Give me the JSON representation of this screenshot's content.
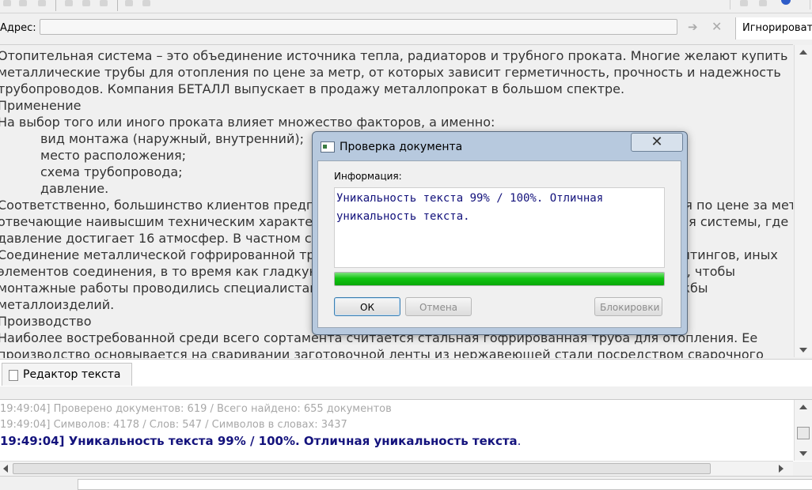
{
  "address_bar": {
    "label": "Адрес:",
    "value": "",
    "ignore_label": "Игнорировать"
  },
  "editor": {
    "lines": [
      "Отопительная система – это объединение источника тепла, радиаторов и трубного проката. Многие желают  купить",
      "металлические трубы для отопления по цене за метр, от которых зависит герметичность, прочность и надежность",
      "трубопроводов. Компания БЕТАЛЛ выпускает в продажу металлопрокат в большом спектре.",
      "Применение",
      "На выбор того или иного проката влияет множество факторов, а именно:",
      "вид монтажа (наружный, внутренний);",
      "место расположения;",
      "схема трубопровода;",
      "давление.",
      "Соответственно, большинство клиентов предпочитают покупать металлические трубы для отопления по цене за метр,",
      "отвечающие наивысшим техническим характеристикам, которые можно использовать в том числе для системы, где",
      "давление достигает 16 атмосфер. В частном строительстве важную роль играет и цена трубы.",
      "Соединение металлической гофрированной трубы с другими элементами выполняется с помощью фитингов, иных",
      "элементов соединения, в то время как гладкую трубу можно сваривать. Производитель рекомендует, чтобы",
      "монтажные работы проводились специалистами, например, сотрудниками специализированной службы",
      "металлоизделий.",
      "Производство",
      "Наиболее востребованной среди всего сортамента считается стальная гофрированная труба для отопления. Ее",
      "производство основывается на сваривании заготовочной ленты из нержавеющей стали  посредством сварочного"
    ]
  },
  "tabs": {
    "editor_tab": "Редактор текста"
  },
  "log": {
    "line1": "19:49:04] Проверено документов: 619  / Всего найдено: 655 документов",
    "line2": "19:49:04] Символов: 4178 / Слов: 547 / Символов в словах: 3437",
    "line3": "19:49:04] Уникальность текста 99% / 100%. Отличная уникальность текста",
    "line3_tail": "."
  },
  "dialog": {
    "title": "Проверка документа",
    "info_label": "Информация:",
    "info_text_1": "Уникальность текста 99% / 100%. Отличная",
    "info_text_2": "уникальность текста.",
    "progress": 1.0,
    "buttons": {
      "ok": "ОК",
      "cancel": "Отмена",
      "block": "Блокировки"
    }
  },
  "colors": {
    "log_highlight": "#14137d",
    "progress": "#10c510",
    "dialog_frame": "#b7c9de"
  }
}
